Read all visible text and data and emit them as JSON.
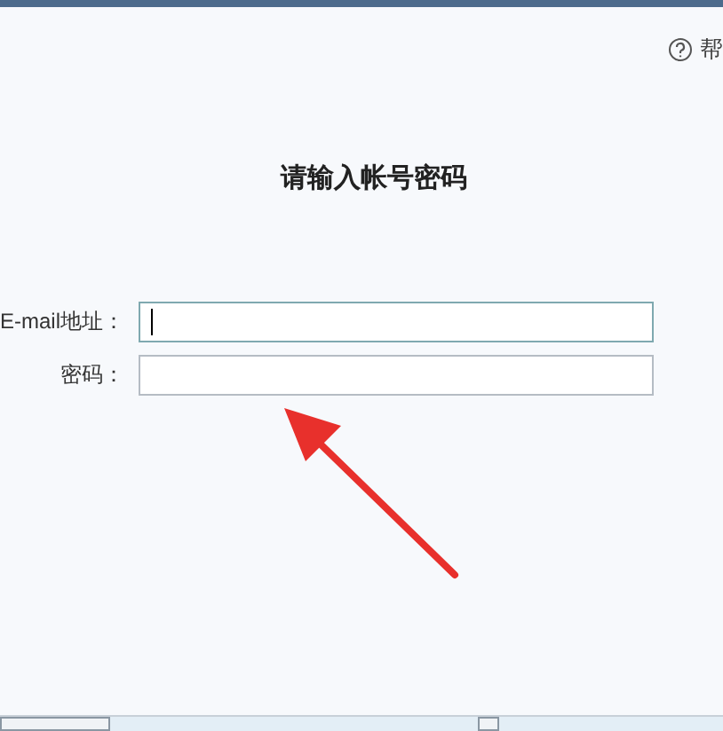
{
  "help_link": "帮",
  "title": "请输入帐号密码",
  "fields": [
    {
      "label": "E-mail地址：",
      "focused": true
    },
    {
      "label": "密码：",
      "focused": false
    }
  ]
}
